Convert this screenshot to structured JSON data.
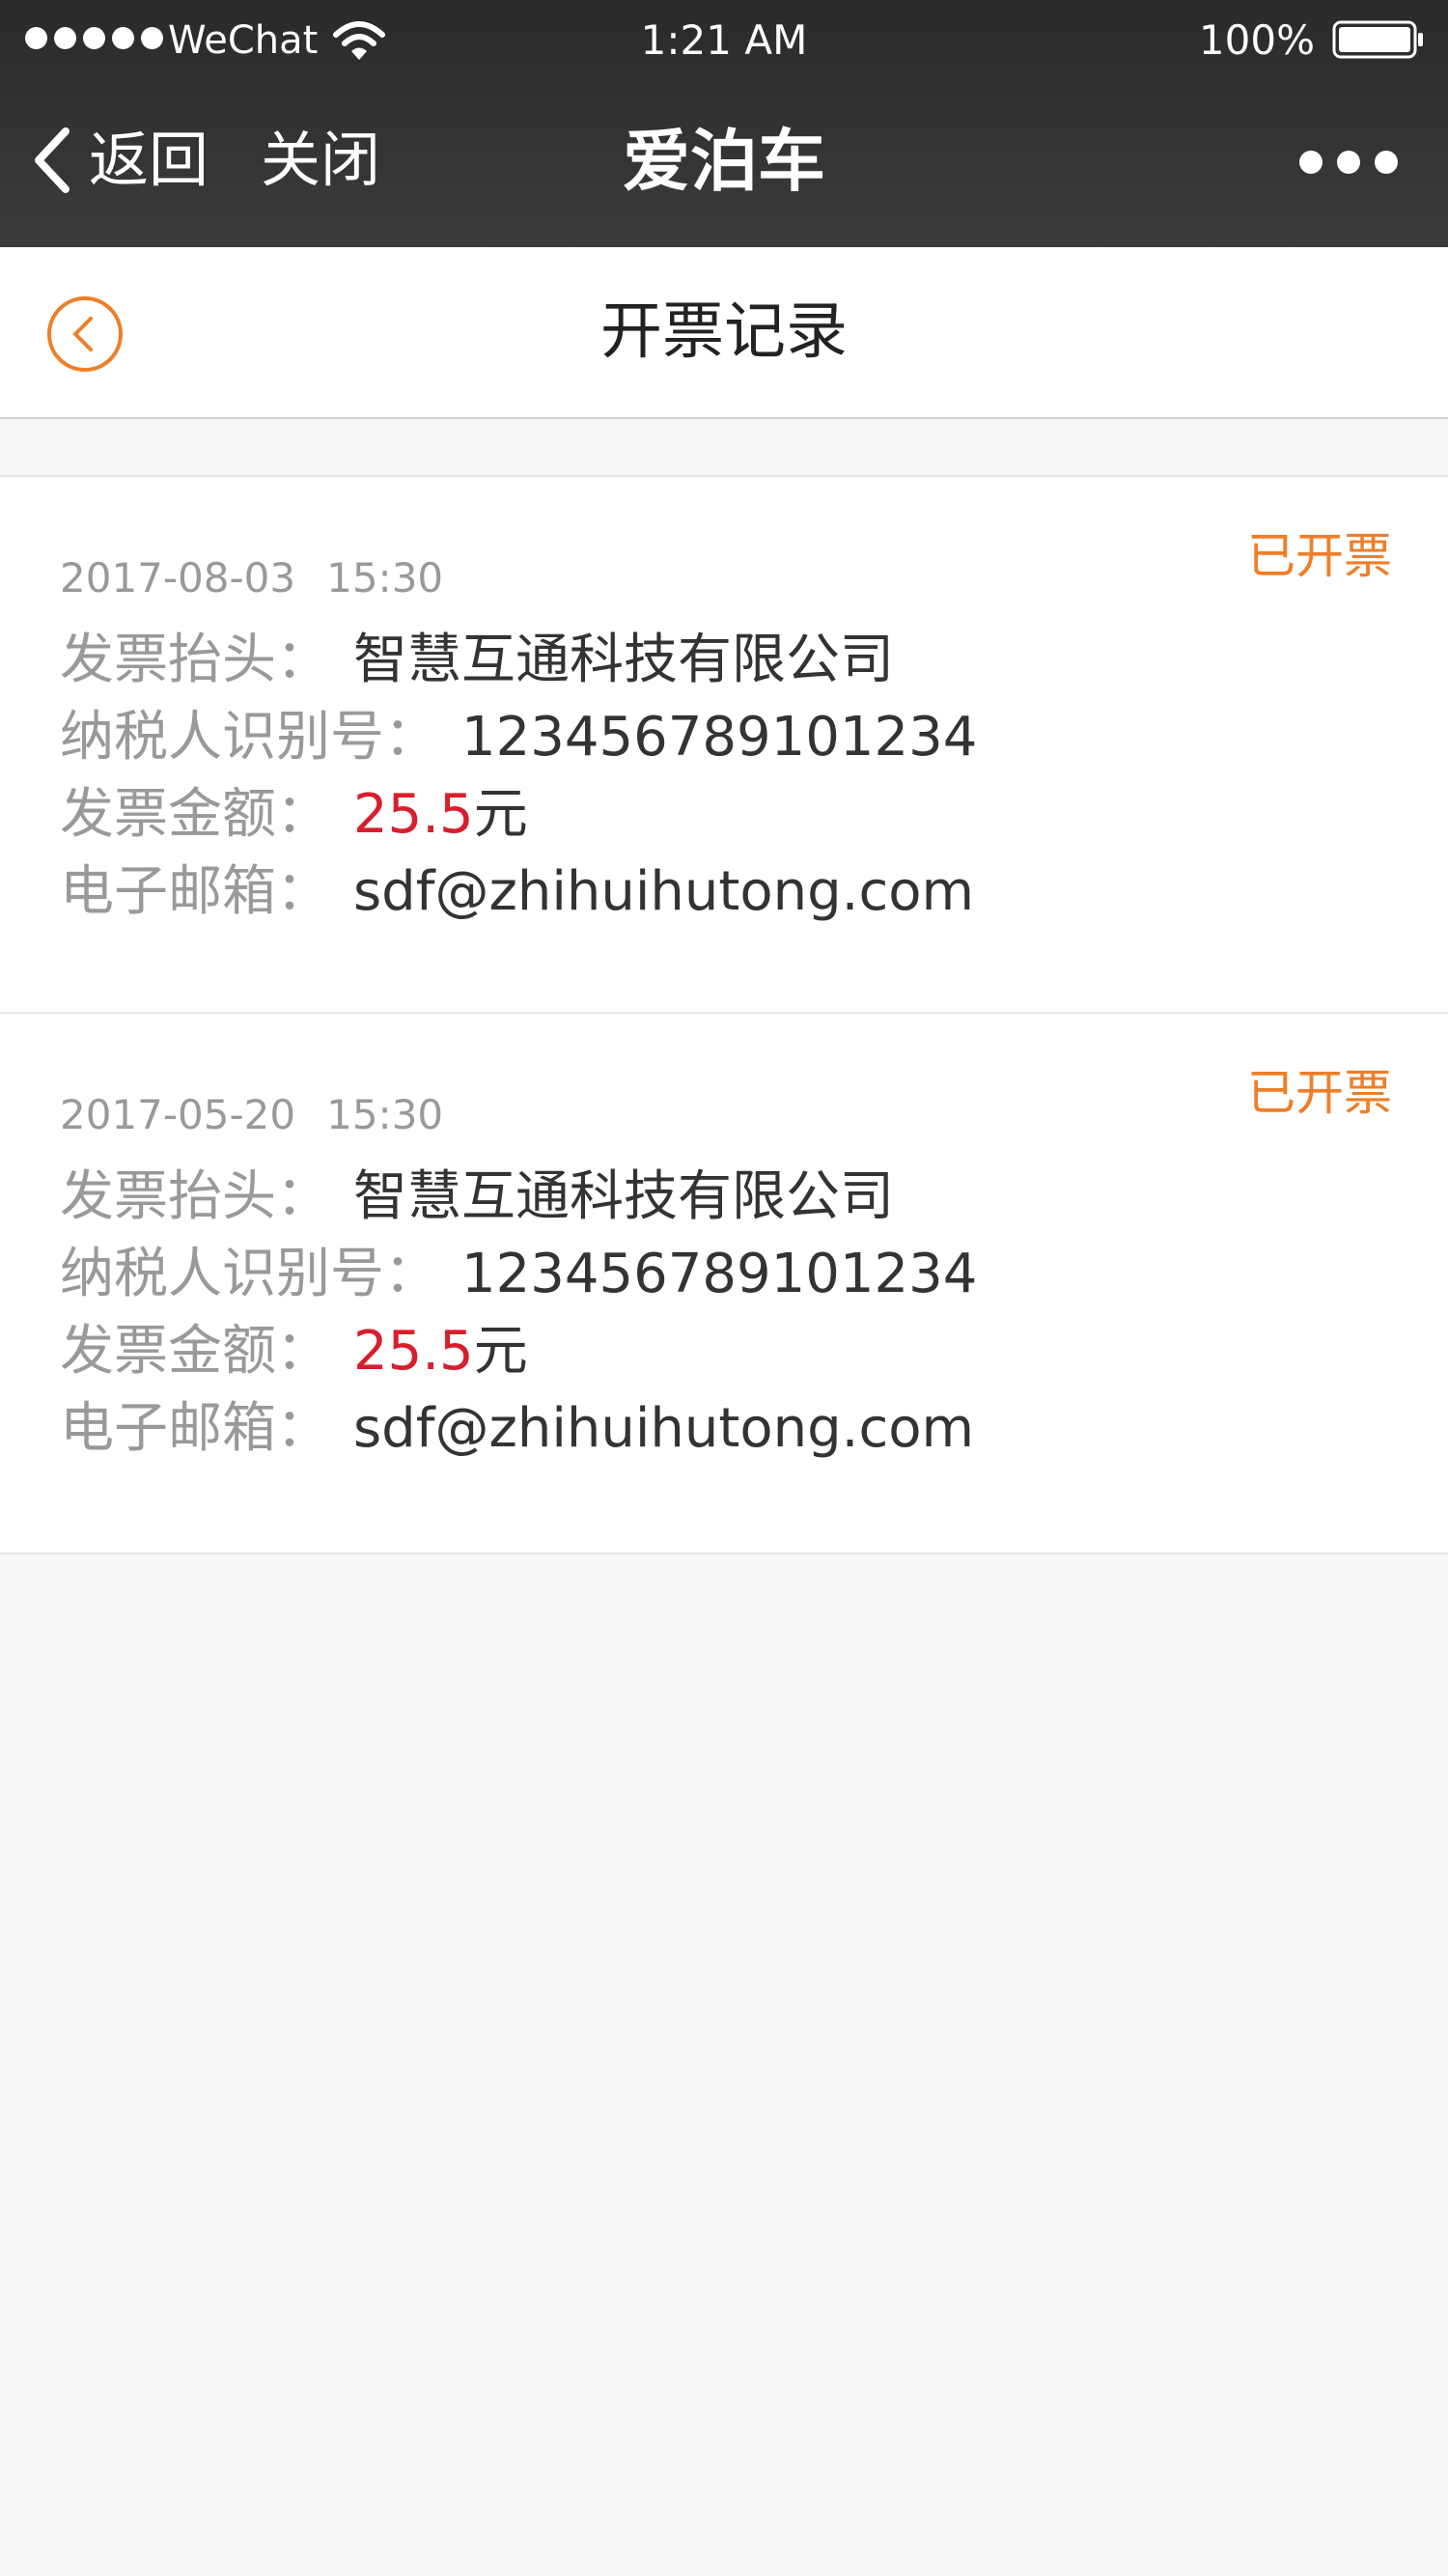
{
  "status_bar": {
    "carrier": "WeChat",
    "time": "1:21 AM",
    "battery": "100%"
  },
  "wechat_nav": {
    "back_label": "返回",
    "close_label": "关闭",
    "title": "爱泊车"
  },
  "page": {
    "title": "开票记录"
  },
  "labels": {
    "invoice_header": "发票抬头",
    "taxpayer_id": "纳税人识别号",
    "invoice_amount": "发票金额",
    "email": "电子邮箱",
    "separator": "：",
    "currency_unit": "元"
  },
  "records": [
    {
      "date": "2017-08-03",
      "time": "15:30",
      "status": "已开票",
      "invoice_header": "智慧互通科技有限公司",
      "taxpayer_id": "123456789101234",
      "amount": "25.5",
      "email": "sdf@zhihuihutong.com"
    },
    {
      "date": "2017-05-20",
      "time": "15:30",
      "status": "已开票",
      "invoice_header": "智慧互通科技有限公司",
      "taxpayer_id": "123456789101234",
      "amount": "25.5",
      "email": "sdf@zhihuihutong.com"
    }
  ],
  "colors": {
    "accent": "#ee7e28",
    "amount": "#d81e2c",
    "chrome": "#333335",
    "background": "#f6f7f9"
  }
}
